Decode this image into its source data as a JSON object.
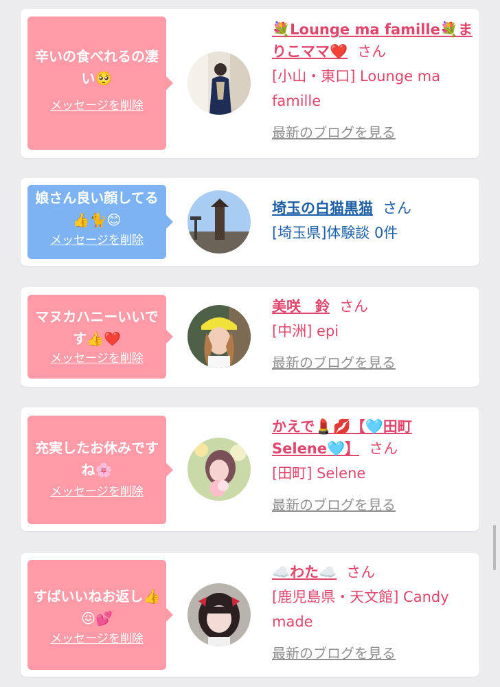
{
  "items": [
    {
      "message": "辛いの食べれるの凄い🥺",
      "delete_label": "メッセージを削除",
      "name": "💐Lounge ma famille💐まりこママ❤️",
      "san": "さん",
      "shop": "[小山・東口] Lounge ma famille",
      "blog_label": "最新のブログを見る",
      "bubble_color": "#ff9aa6"
    },
    {
      "message": "娘さん良い顔してる👍🐈😊",
      "delete_label": "メッセージを削除",
      "name": "埼玉の白猫黒猫",
      "san": "さん",
      "shop": "[埼玉県]体験談 0件",
      "bubble_color": "#7db3f3"
    },
    {
      "message": "マヌカハニーいいです👍❤️",
      "delete_label": "メッセージを削除",
      "name": "美咲　鈴",
      "san": "さん",
      "shop": "[中洲] epi",
      "blog_label": "最新のブログを見る",
      "bubble_color": "#ff9aa6"
    },
    {
      "message": "充実したお休みですね🌸",
      "delete_label": "メッセージを削除",
      "name": "かえで💄💋【🩵田町Selene🩵】",
      "san": "さん",
      "shop": "[田町] Selene",
      "blog_label": "最新のブログを見る",
      "bubble_color": "#ff9aa6"
    },
    {
      "message": "すばいいねお返し👍😖💕",
      "delete_label": "メッセージを削除",
      "name": "☁️わた☁️",
      "san": "さん",
      "shop": "[鹿児島県・天文館] Candy made",
      "blog_label": "最新のブログを見る",
      "bubble_color": "#ff9aa6"
    }
  ]
}
